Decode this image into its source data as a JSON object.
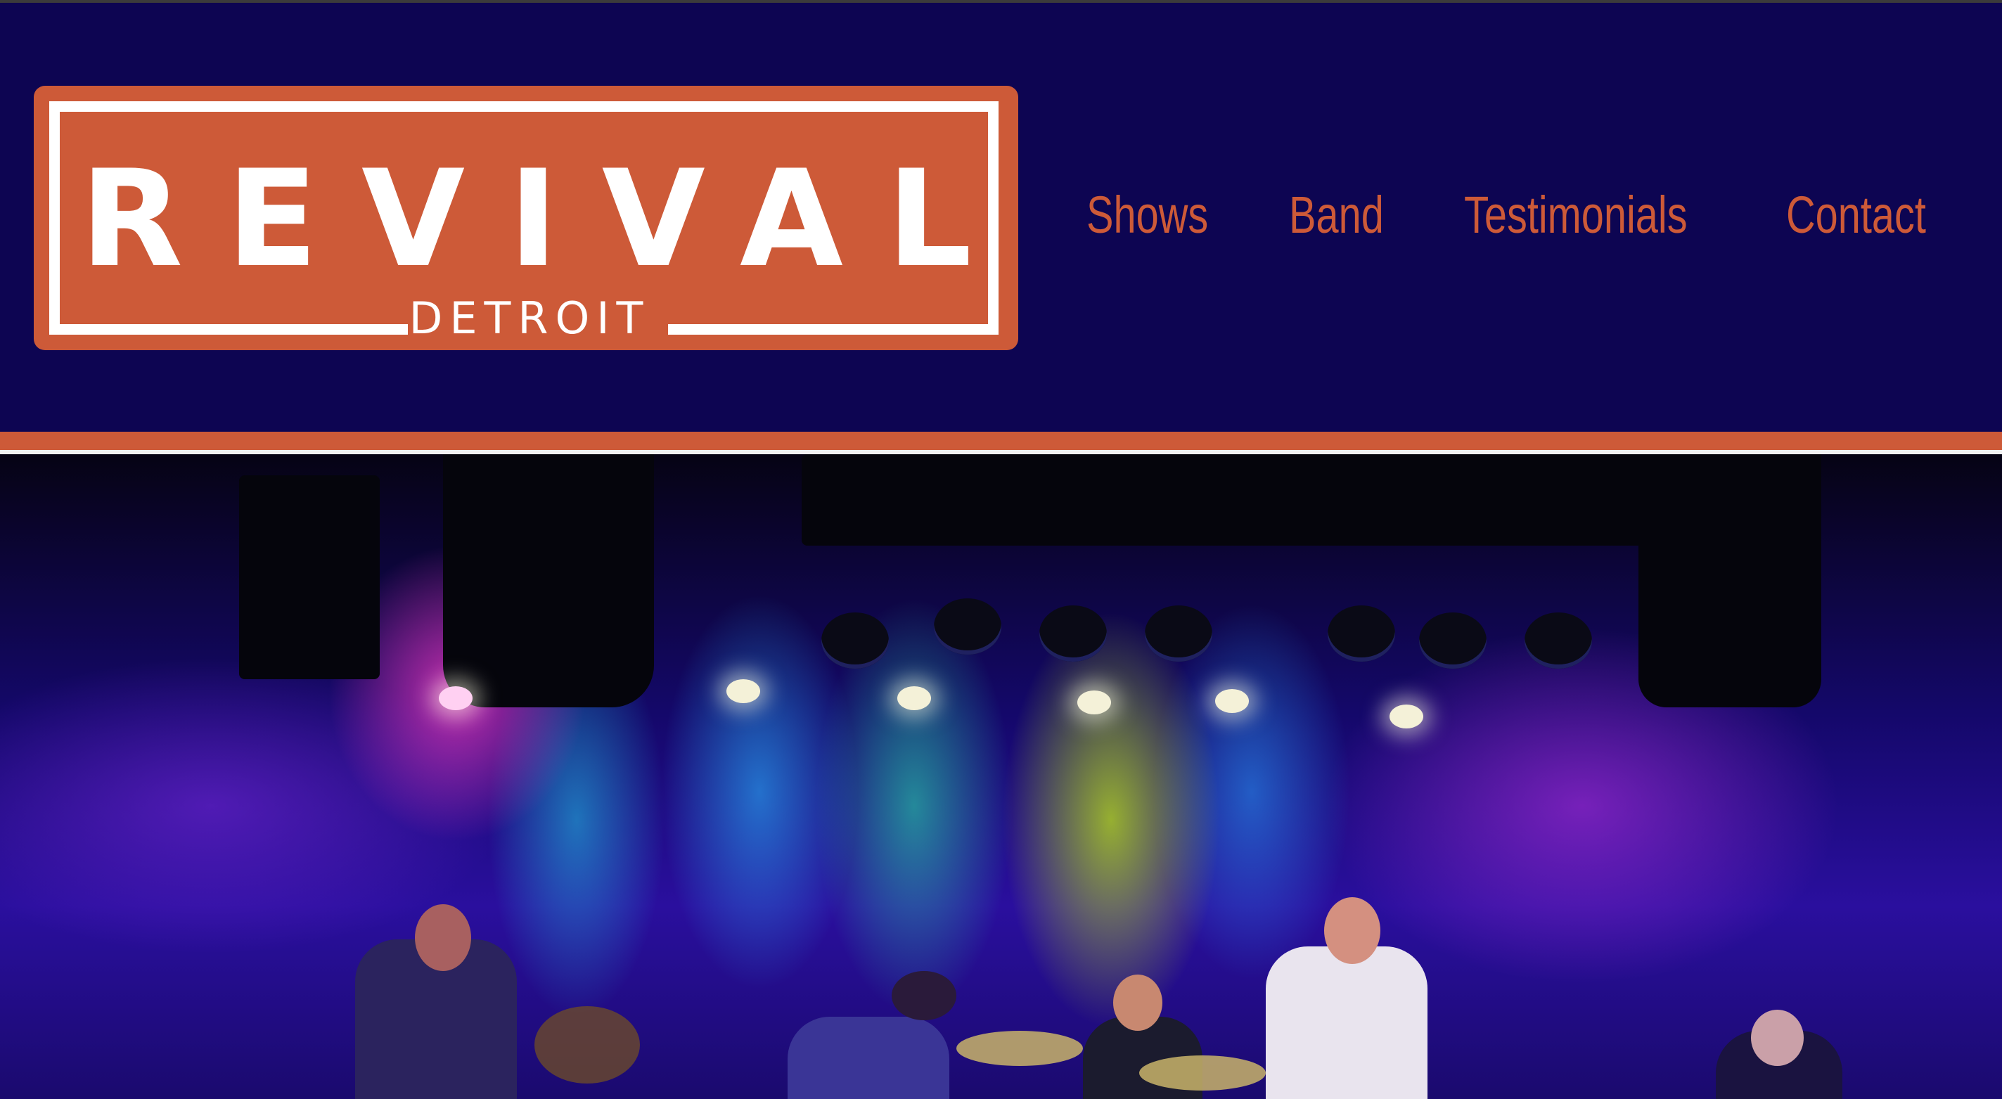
{
  "site": {
    "logo": {
      "title": "REVIVAL",
      "subtitle": "DETROIT"
    },
    "nav": [
      {
        "label": "Shows"
      },
      {
        "label": "Band"
      },
      {
        "label": "Testimonials"
      },
      {
        "label": "Contact"
      }
    ]
  },
  "colors": {
    "header_bg": "#0d0552",
    "accent": "#cd5a38",
    "logo_text": "#ffffff"
  },
  "icons": {
    "logo": "revival-detroit-logo"
  }
}
